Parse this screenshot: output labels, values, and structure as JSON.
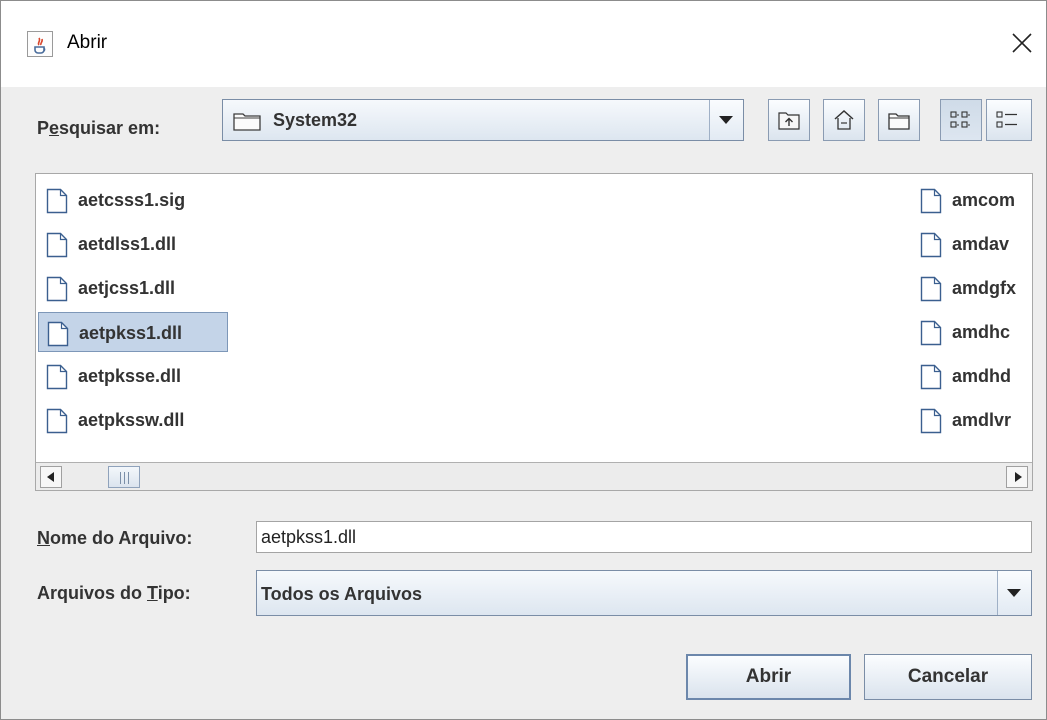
{
  "dialog": {
    "title": "Abrir",
    "icons": {
      "app": "java-cup-icon",
      "close": "close-icon"
    }
  },
  "look_in": {
    "label_pre": "P",
    "label_mnemonic": "e",
    "label_post": "squisar em:",
    "folder": "System32",
    "folder_icon": "folder-icon"
  },
  "toolbar": {
    "buttons": [
      "up-one-level-icon",
      "home-icon",
      "new-folder-icon",
      "list-view-icon",
      "details-view-icon"
    ],
    "active_view": "list-view"
  },
  "files": {
    "left_column": [
      "aetcsss1.sig",
      "aetdlss1.dll",
      "aetjcss1.dll",
      "aetpkss1.dll",
      "aetpksse.dll",
      "aetpkssw.dll"
    ],
    "right_column": [
      "amcom",
      "amdav",
      "amdgfx",
      "amdhc",
      "amdhd",
      "amdlvr"
    ],
    "selected": "aetpkss1.dll",
    "file_icon": "file-icon"
  },
  "file_name": {
    "label_mnemonic": "N",
    "label_post": "ome do Arquivo:",
    "value": "aetpkss1.dll"
  },
  "file_type": {
    "label_pre": "Arquivos do ",
    "label_mnemonic": "T",
    "label_post": "ipo:",
    "value": "Todos os Arquivos"
  },
  "buttons": {
    "open": "Abrir",
    "cancel": "Cancelar"
  },
  "colors": {
    "selection": "#c4d4e8",
    "selection_border": "#7d97b8",
    "window_bg": "#eeeeee",
    "button_border": "#7a8da6"
  }
}
